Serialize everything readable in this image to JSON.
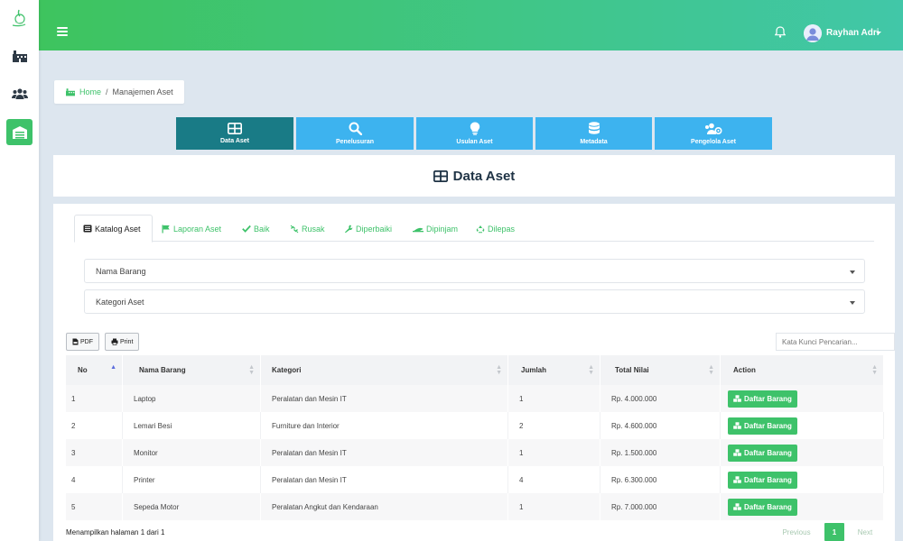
{
  "header": {
    "user_name": "Rayhan Adri"
  },
  "breadcrumb": {
    "home": "Home",
    "separator": "/",
    "current": "Manajemen Aset"
  },
  "modules": [
    {
      "label": "Data Aset",
      "icon": "table-icon",
      "active": true
    },
    {
      "label": "Penelusuran",
      "icon": "search-icon",
      "active": false
    },
    {
      "label": "Usulan Aset",
      "icon": "lightbulb-icon",
      "active": false
    },
    {
      "label": "Metadata",
      "icon": "database-icon",
      "active": false
    },
    {
      "label": "Pengelola Aset",
      "icon": "users-cog-icon",
      "active": false
    }
  ],
  "page_title": "Data Aset",
  "tabs": [
    {
      "label": "Katalog Aset",
      "icon": "list-icon",
      "active": true
    },
    {
      "label": "Laporan Aset",
      "icon": "flag-icon",
      "active": false
    },
    {
      "label": "Baik",
      "icon": "check-icon",
      "active": false
    },
    {
      "label": "Rusak",
      "icon": "broken-link-icon",
      "active": false
    },
    {
      "label": "Diperbaiki",
      "icon": "wrench-icon",
      "active": false
    },
    {
      "label": "Dipinjam",
      "icon": "hand-icon",
      "active": false
    },
    {
      "label": "Dilepas",
      "icon": "recycle-icon",
      "active": false
    }
  ],
  "filters": {
    "nama_barang": "Nama Barang",
    "kategori": "Kategori Aset"
  },
  "toolbar": {
    "pdf_label": "PDF",
    "print_label": "Print",
    "search_placeholder": "Kata Kunci Pencarian..."
  },
  "table": {
    "columns": [
      "No",
      "Nama Barang",
      "Kategori",
      "Jumlah",
      "Total Nilai",
      "Action"
    ],
    "rows": [
      {
        "no": "1",
        "nama": "Laptop",
        "kategori": "Peralatan dan Mesin IT",
        "jumlah": "1",
        "total": "Rp. 4.000.000",
        "action": "Daftar Barang"
      },
      {
        "no": "2",
        "nama": "Lemari Besi",
        "kategori": "Furniture dan Interior",
        "jumlah": "2",
        "total": "Rp. 4.600.000",
        "action": "Daftar Barang"
      },
      {
        "no": "3",
        "nama": "Monitor",
        "kategori": "Peralatan dan Mesin IT",
        "jumlah": "1",
        "total": "Rp. 1.500.000",
        "action": "Daftar Barang"
      },
      {
        "no": "4",
        "nama": "Printer",
        "kategori": "Peralatan dan Mesin IT",
        "jumlah": "4",
        "total": "Rp. 6.300.000",
        "action": "Daftar Barang"
      },
      {
        "no": "5",
        "nama": "Sepeda Motor",
        "kategori": "Peralatan Angkut dan Kendaraan",
        "jumlah": "1",
        "total": "Rp. 7.000.000",
        "action": "Daftar Barang"
      }
    ]
  },
  "pagination": {
    "info": "Menampilkan halaman 1 dari 1",
    "previous": "Previous",
    "current": "1",
    "next": "Next"
  },
  "colors": {
    "primary_green": "#3ec26a",
    "module_active": "#197b86",
    "module_blue": "#3db3ef"
  }
}
